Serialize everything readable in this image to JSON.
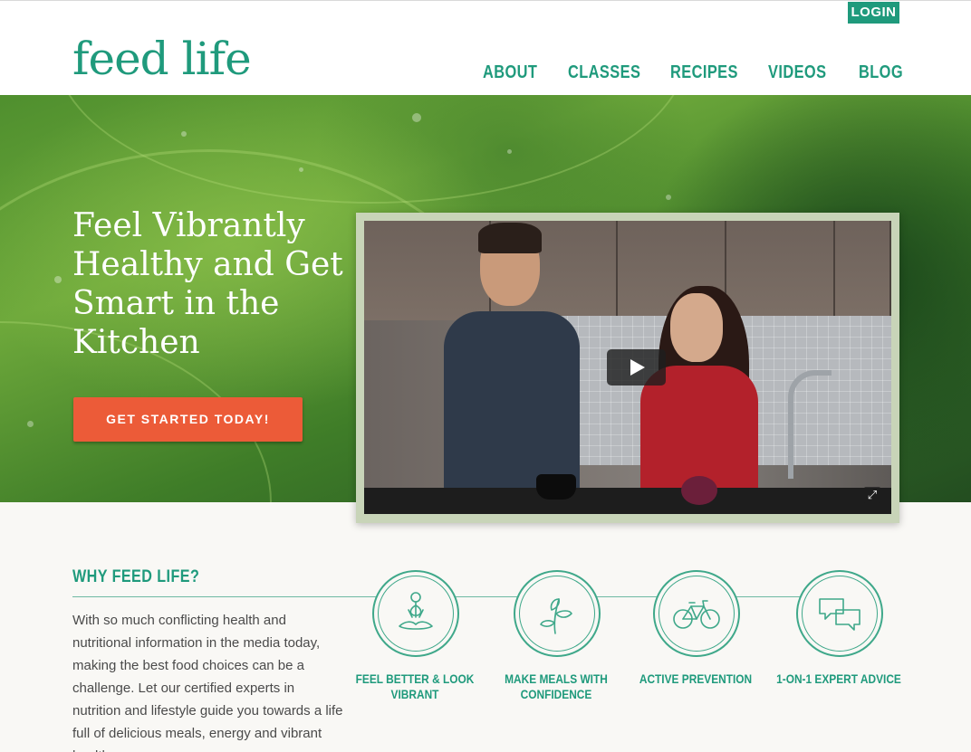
{
  "brand": {
    "logo_text": "feed life",
    "accent_color": "#1f9a7c",
    "cta_color": "#ec5b38"
  },
  "header": {
    "login_label": "LOGIN",
    "nav": [
      {
        "label": "ABOUT"
      },
      {
        "label": "CLASSES"
      },
      {
        "label": "RECIPES"
      },
      {
        "label": "VIDEOS"
      },
      {
        "label": "BLOG"
      }
    ]
  },
  "hero": {
    "title": "Feel Vibrantly Healthy and Get Smart in the Kitchen",
    "cta_label": "GET STARTED TODAY!",
    "video": {
      "play_icon": "play-icon",
      "fullscreen_icon": "fullscreen-icon"
    }
  },
  "why": {
    "title": "WHY FEED LIFE?",
    "body": "With so much conflicting health and nutritional information in the media today, making the best food choices can be a challenge. Let our certified experts in nutrition and lifestyle guide you towards a life full of delicious meals, energy and vibrant health.",
    "features": [
      {
        "label": "FEEL BETTER & LOOK VIBRANT",
        "icon": "meditation-icon"
      },
      {
        "label": "MAKE MEALS WITH CONFIDENCE",
        "icon": "plant-icon"
      },
      {
        "label": "ACTIVE PREVENTION",
        "icon": "bicycle-icon"
      },
      {
        "label": "1-ON-1 EXPERT ADVICE",
        "icon": "chat-bubbles-icon"
      }
    ]
  }
}
